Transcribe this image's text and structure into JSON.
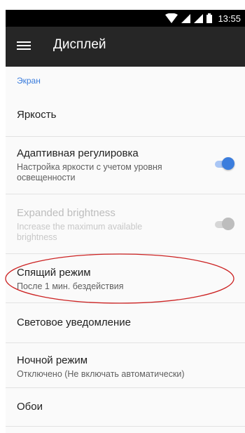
{
  "status_bar": {
    "icons": [
      "wifi-icon",
      "signal-icon",
      "signal-icon",
      "battery-icon"
    ],
    "time": "13:55"
  },
  "toolbar": {
    "menu_icon": "menu-icon",
    "title": "Дисплей"
  },
  "section": {
    "header": "Экран"
  },
  "items": [
    {
      "title": "Яркость"
    },
    {
      "title": "Адаптивная регулировка",
      "summary": "Настройка яркости с учетом уровня освещенности",
      "toggle": true,
      "enabled": true
    },
    {
      "title": "Expanded brightness",
      "summary": "Increase the maximum available brightness",
      "toggle": true,
      "enabled": false
    },
    {
      "title": "Спящий режим",
      "summary": "После 1 мин. бездействия"
    },
    {
      "title": "Световое уведомление"
    },
    {
      "title": "Ночной режим",
      "summary": "Отключено (Не включать автоматически)"
    },
    {
      "title": "Обои"
    }
  ],
  "colors": {
    "accent": "#3b7ddd",
    "section_header": "#3a7cdc",
    "toolbar_bg": "#262626",
    "annotation_ellipse": "#cc2222"
  }
}
